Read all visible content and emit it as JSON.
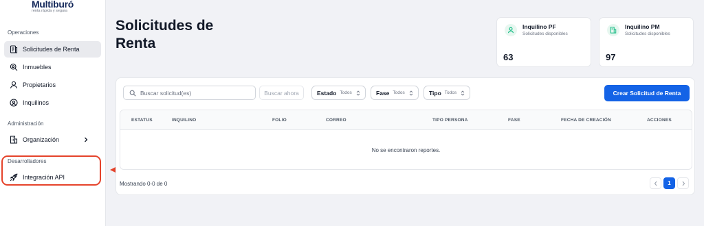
{
  "brand": {
    "name": "Multiburó",
    "tagline": "renta rápida y segura"
  },
  "sidebar": {
    "sections": [
      {
        "label": "Operaciones"
      },
      {
        "label": "Administración"
      },
      {
        "label": "Desarrolladores"
      }
    ],
    "items": [
      {
        "label": "Solicitudes de Renta",
        "icon": "document-icon",
        "active": true
      },
      {
        "label": "Inmuebles",
        "icon": "search-icon"
      },
      {
        "label": "Propietarios",
        "icon": "user-icon"
      },
      {
        "label": "Inquilinos",
        "icon": "users-icon"
      },
      {
        "label": "Organización",
        "icon": "building-icon"
      },
      {
        "label": "Integración API",
        "icon": "rocket-icon"
      }
    ]
  },
  "header": {
    "title": "Solicitudes de Renta"
  },
  "stats": [
    {
      "title": "Inquilino PF",
      "subtitle": "Solicitudes disponibles",
      "value": "63",
      "icon": "user-icon",
      "color": "#10b981"
    },
    {
      "title": "Inquilino PM",
      "subtitle": "Solicitudes disponibles",
      "value": "97",
      "icon": "building-icon",
      "color": "#10b981"
    }
  ],
  "toolbar": {
    "search_placeholder": "Buscar solicitud(es)",
    "search_button": "Buscar ahora",
    "filters": [
      {
        "label": "Estado",
        "value": "Todos"
      },
      {
        "label": "Fase",
        "value": "Todos"
      },
      {
        "label": "Tipo",
        "value": "Todos"
      }
    ],
    "create_button": "Crear Solicitud de Renta"
  },
  "table": {
    "columns": [
      "ESTATUS",
      "INQUILINO",
      "FOLIO",
      "CORREO",
      "TIPO PERSONA",
      "FASE",
      "FECHA DE CREACIÓN",
      "ACCIONES"
    ],
    "empty_message": "No se encontraron reportes."
  },
  "footer": {
    "showing": "Mostrando 0-0 de 0",
    "current_page": "1"
  },
  "colors": {
    "accent": "#1463e6",
    "highlight": "#e5422a",
    "stat_icon": "#10b981"
  }
}
